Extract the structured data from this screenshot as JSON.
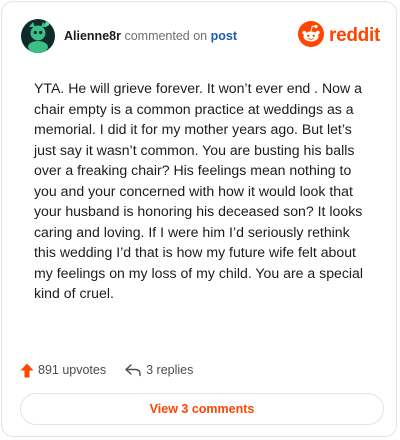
{
  "comment": {
    "username": "Alienne8r",
    "action_text": "commented on",
    "post_link": "post",
    "body": "YTA. He will grieve forever. It won’t ever end . Now a chair empty is a common practice at weddings as a memorial. I did it for my mother years ago. But let’s just say it wasn’t common. You are busting his balls over a freaking chair? His feelings mean nothing to you and your concerned with how it would look that your husband is honoring his deceased son? It looks caring and loving. If I were him I’d seriously rethink this wedding I’d that is how my future wife felt about my feelings on my loss of my child. You are a special kind of cruel."
  },
  "brand": {
    "wordmark": "reddit",
    "icon": "reddit-logo-icon",
    "color": "#ff4500"
  },
  "actions": {
    "upvotes": "891 upvotes",
    "upvote_icon": "upvote-arrow-icon",
    "replies": "3 replies",
    "reply_icon": "reply-arrow-icon"
  },
  "footer": {
    "view_comments": "View 3 comments"
  },
  "colors": {
    "accent": "#ff4500",
    "link": "#1d5bb8",
    "avatar_bg": "#0f2a2a",
    "avatar_figure": "#3bbf86"
  }
}
